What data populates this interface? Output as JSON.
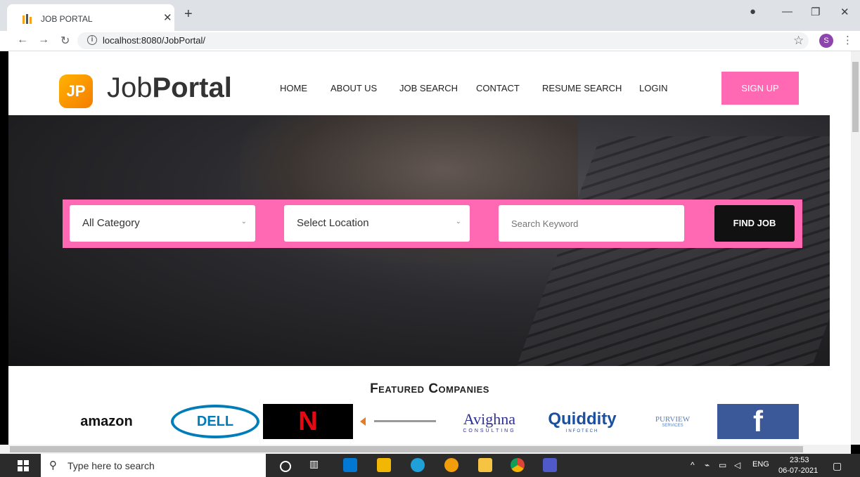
{
  "browser": {
    "tab_title": "JOB PORTAL",
    "url": "localhost:8080/JobPortal/",
    "profile_initial": "S"
  },
  "site": {
    "logo_mark": "JP",
    "logo_text_1": "Job",
    "logo_text_2": "Portal",
    "nav": [
      "HOME",
      "ABOUT US",
      "JOB SEARCH",
      "CONTACT",
      "RESUME SEARCH",
      "LOGIN"
    ],
    "signup": "SIGN UP"
  },
  "search": {
    "category": "All Category",
    "location": "Select Location",
    "keyword_placeholder": "Search Keyword",
    "button": "FIND JOB"
  },
  "featured": {
    "title": "Featured Companies",
    "logos": [
      "amazon",
      "DELL",
      "N",
      "Avighna",
      "CONSULTING",
      "Quiddity",
      "INFOTECH",
      "PURVIEW",
      "SERVICES",
      "f"
    ]
  },
  "taskbar": {
    "search_placeholder": "Type here to search",
    "lang": "ENG",
    "time": "23:53",
    "date": "06-07-2021"
  },
  "colors": {
    "accent": "#ff69b4",
    "brand_orange": "#f7a21b"
  }
}
